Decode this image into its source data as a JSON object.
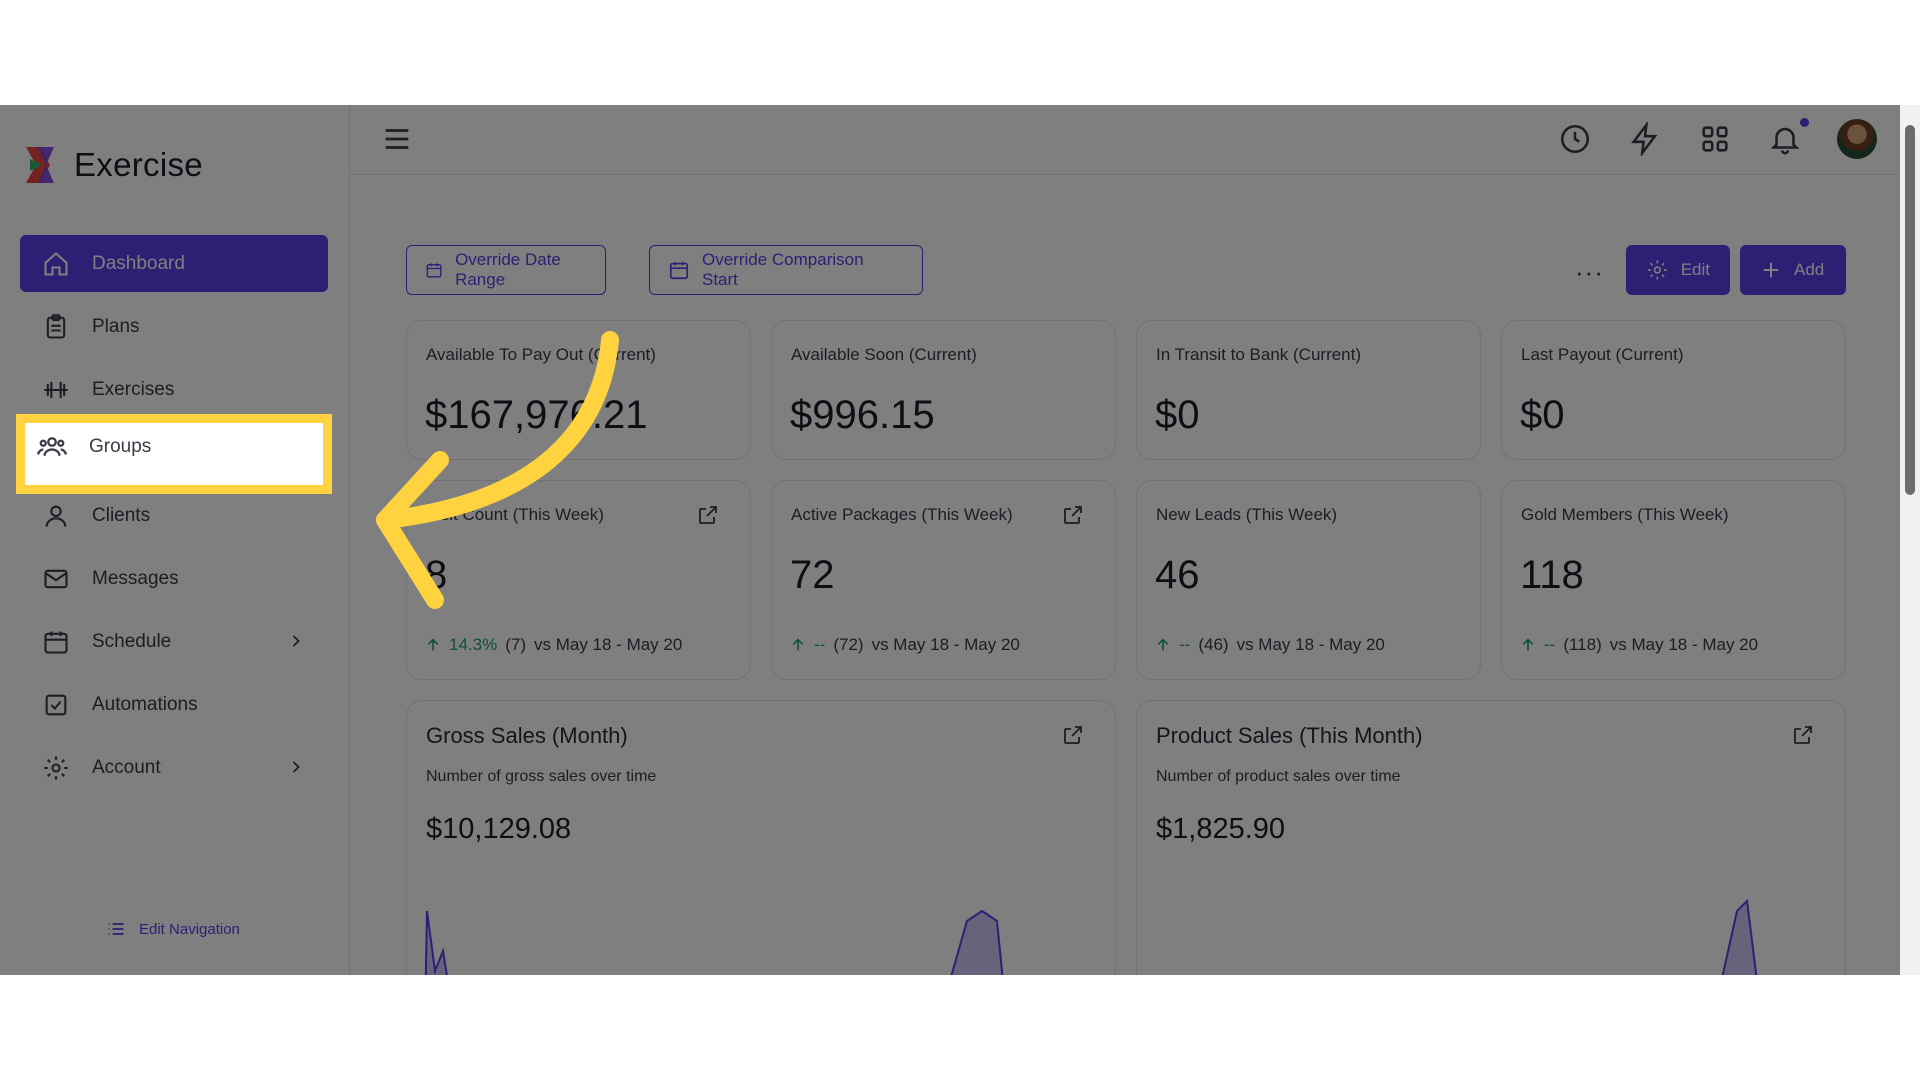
{
  "app": {
    "title": "Exercise"
  },
  "sidebar": {
    "items": [
      {
        "label": "Dashboard",
        "icon": "home-icon",
        "active": true
      },
      {
        "label": "Plans",
        "icon": "clipboard-icon"
      },
      {
        "label": "Exercises",
        "icon": "dumbbell-icon"
      },
      {
        "label": "Groups",
        "icon": "users-icon",
        "highlighted": true
      },
      {
        "label": "Clients",
        "icon": "user-icon"
      },
      {
        "label": "Messages",
        "icon": "mail-icon"
      },
      {
        "label": "Schedule",
        "icon": "calendar-icon",
        "has_submenu": true
      },
      {
        "label": "Automations",
        "icon": "checkbox-icon"
      },
      {
        "label": "Account",
        "icon": "gear-icon",
        "has_submenu": true
      }
    ],
    "edit_navigation": "Edit Navigation"
  },
  "toolbar": {
    "override_date_range": "Override Date Range",
    "override_comparison_start": "Override Comparison Start",
    "edit": "Edit",
    "add": "Add",
    "more": "···"
  },
  "stats_row1": [
    {
      "title": "Available To Pay Out (Current)",
      "value": "$167,976.21"
    },
    {
      "title": "Available Soon (Current)",
      "value": "$996.15"
    },
    {
      "title": "In Transit to Bank (Current)",
      "value": "$0"
    },
    {
      "title": "Last Payout (Current)",
      "value": "$0"
    }
  ],
  "stats_row2": [
    {
      "title": "Visit Count (This Week)",
      "value": "8",
      "change": "14.3%",
      "previous": "(7)",
      "comparison": "vs May 18 - May 20"
    },
    {
      "title": "Active Packages (This Week)",
      "value": "72",
      "change": "--",
      "previous": "(72)",
      "comparison": "vs May 18 - May 20"
    },
    {
      "title": "New Leads (This Week)",
      "value": "46",
      "change": "--",
      "previous": "(46)",
      "comparison": "vs May 18 - May 20"
    },
    {
      "title": "Gold Members (This Week)",
      "value": "118",
      "change": "--",
      "previous": "(118)",
      "comparison": "vs May 18 - May 20"
    }
  ],
  "charts": [
    {
      "title": "Gross Sales (Month)",
      "subtitle": "Number of gross sales over time",
      "value": "$10,129.08"
    },
    {
      "title": "Product Sales (This Month)",
      "subtitle": "Number of product sales over time",
      "value": "$1,825.90"
    }
  ],
  "colors": {
    "accent": "#5a3ee8",
    "highlight": "#ffd33f",
    "trend_up": "#1ba37a"
  }
}
